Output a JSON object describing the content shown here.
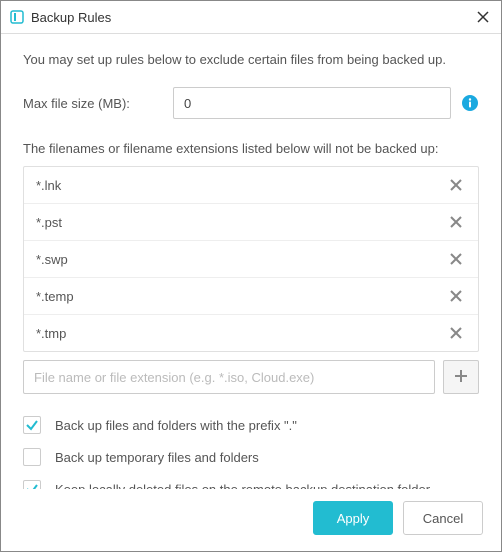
{
  "titlebar": {
    "title": "Backup Rules"
  },
  "intro": "You may set up rules below to exclude certain files from being backed up.",
  "max_size": {
    "label": "Max file size (MB):",
    "value": "0"
  },
  "exclude_label": "The filenames or filename extensions listed below will not be backed up:",
  "exclude_items": [
    {
      "ext": "*.lnk"
    },
    {
      "ext": "*.pst"
    },
    {
      "ext": "*.swp"
    },
    {
      "ext": "*.temp"
    },
    {
      "ext": "*.tmp"
    }
  ],
  "add_input": {
    "placeholder": "File name or file extension (e.g. *.iso, Cloud.exe)"
  },
  "checkboxes": {
    "prefix_dot": {
      "label": "Back up files and folders with the prefix \".\"",
      "checked": true
    },
    "temp_files": {
      "label": "Back up temporary files and folders",
      "checked": false
    },
    "keep_deleted": {
      "label": "Keep locally deleted files on the remote backup destination folder",
      "checked": true
    }
  },
  "buttons": {
    "apply": "Apply",
    "cancel": "Cancel"
  },
  "colors": {
    "accent": "#22bcd1"
  }
}
